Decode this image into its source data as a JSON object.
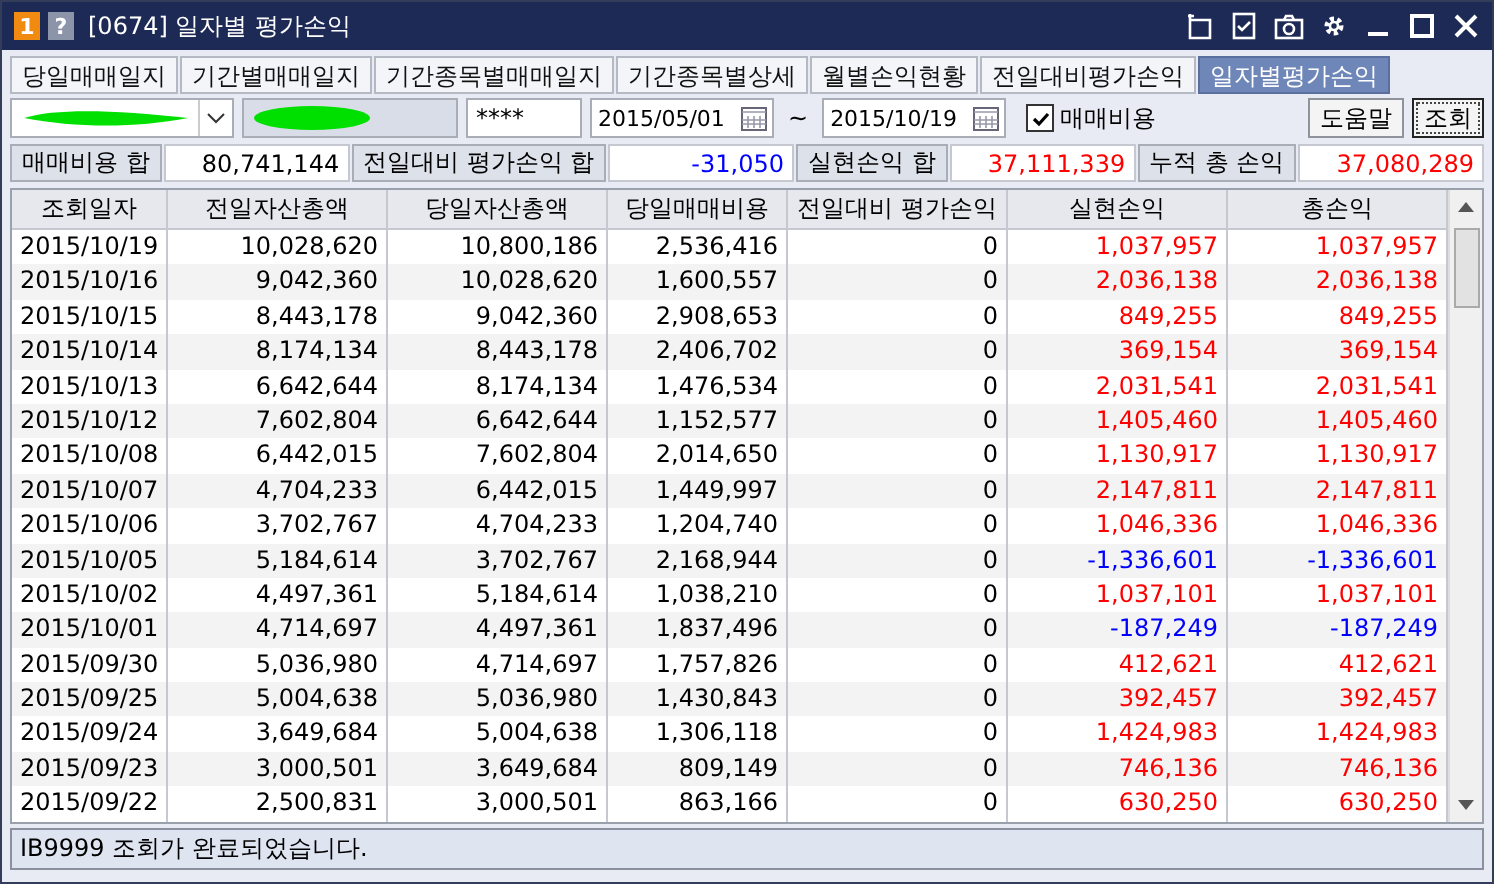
{
  "window": {
    "badge": "1",
    "help": "?",
    "title": "[0674] 일자별 평가손익"
  },
  "tabs": [
    {
      "label": "당일매매일지",
      "selected": false
    },
    {
      "label": "기간별매매일지",
      "selected": false
    },
    {
      "label": "기간종목별매매일지",
      "selected": false
    },
    {
      "label": "기간종목별상세",
      "selected": false
    },
    {
      "label": "월별손익현황",
      "selected": false
    },
    {
      "label": "전일대비평가손익",
      "selected": false
    },
    {
      "label": "일자별평가손익",
      "selected": true
    }
  ],
  "controls": {
    "password": "****",
    "start_date": "2015/05/01",
    "separator": "~",
    "end_date": "2015/10/19",
    "fee_checkbox": {
      "label": "매매비용",
      "checked": true
    },
    "buttons": [
      "도움말",
      "조회"
    ]
  },
  "summary": [
    {
      "label": "매매비용 합",
      "value": "80,741,144",
      "color": "#000000"
    },
    {
      "label": "전일대비 평가손익 합",
      "value": "-31,050",
      "color": "#0000ff"
    },
    {
      "label": "실현손익 합",
      "value": "37,111,339",
      "color": "#ff0000"
    },
    {
      "label": "누적 총 손익",
      "value": "37,080,289",
      "color": "#ff0000"
    }
  ],
  "table": {
    "columns": [
      "조회일자",
      "전일자산총액",
      "당일자산총액",
      "당일매매비용",
      "전일대비 평가손익",
      "실현손익",
      "총손익"
    ],
    "rows": [
      {
        "cells": [
          "2015/10/19",
          "10,028,620",
          "10,800,186",
          "2,536,416",
          "0",
          "1,037,957",
          "1,037,957"
        ],
        "color": "#ff0000"
      },
      {
        "cells": [
          "2015/10/16",
          "9,042,360",
          "10,028,620",
          "1,600,557",
          "0",
          "2,036,138",
          "2,036,138"
        ],
        "color": "#ff0000"
      },
      {
        "cells": [
          "2015/10/15",
          "8,443,178",
          "9,042,360",
          "2,908,653",
          "0",
          "849,255",
          "849,255"
        ],
        "color": "#ff0000"
      },
      {
        "cells": [
          "2015/10/14",
          "8,174,134",
          "8,443,178",
          "2,406,702",
          "0",
          "369,154",
          "369,154"
        ],
        "color": "#ff0000"
      },
      {
        "cells": [
          "2015/10/13",
          "6,642,644",
          "8,174,134",
          "1,476,534",
          "0",
          "2,031,541",
          "2,031,541"
        ],
        "color": "#ff0000"
      },
      {
        "cells": [
          "2015/10/12",
          "7,602,804",
          "6,642,644",
          "1,152,577",
          "0",
          "1,405,460",
          "1,405,460"
        ],
        "color": "#ff0000"
      },
      {
        "cells": [
          "2015/10/08",
          "6,442,015",
          "7,602,804",
          "2,014,650",
          "0",
          "1,130,917",
          "1,130,917"
        ],
        "color": "#ff0000"
      },
      {
        "cells": [
          "2015/10/07",
          "4,704,233",
          "6,442,015",
          "1,449,997",
          "0",
          "2,147,811",
          "2,147,811"
        ],
        "color": "#ff0000"
      },
      {
        "cells": [
          "2015/10/06",
          "3,702,767",
          "4,704,233",
          "1,204,740",
          "0",
          "1,046,336",
          "1,046,336"
        ],
        "color": "#ff0000"
      },
      {
        "cells": [
          "2015/10/05",
          "5,184,614",
          "3,702,767",
          "2,168,944",
          "0",
          "-1,336,601",
          "-1,336,601"
        ],
        "color": "#0000ff"
      },
      {
        "cells": [
          "2015/10/02",
          "4,497,361",
          "5,184,614",
          "1,038,210",
          "0",
          "1,037,101",
          "1,037,101"
        ],
        "color": "#ff0000"
      },
      {
        "cells": [
          "2015/10/01",
          "4,714,697",
          "4,497,361",
          "1,837,496",
          "0",
          "-187,249",
          "-187,249"
        ],
        "color": "#0000ff"
      },
      {
        "cells": [
          "2015/09/30",
          "5,036,980",
          "4,714,697",
          "1,757,826",
          "0",
          "412,621",
          "412,621"
        ],
        "color": "#ff0000"
      },
      {
        "cells": [
          "2015/09/25",
          "5,004,638",
          "5,036,980",
          "1,430,843",
          "0",
          "392,457",
          "392,457"
        ],
        "color": "#ff0000"
      },
      {
        "cells": [
          "2015/09/24",
          "3,649,684",
          "5,004,638",
          "1,306,118",
          "0",
          "1,424,983",
          "1,424,983"
        ],
        "color": "#ff0000"
      },
      {
        "cells": [
          "2015/09/23",
          "3,000,501",
          "3,649,684",
          "809,149",
          "0",
          "746,136",
          "746,136"
        ],
        "color": "#ff0000"
      },
      {
        "cells": [
          "2015/09/22",
          "2,500,831",
          "3,000,501",
          "863,166",
          "0",
          "630,250",
          "630,250"
        ],
        "color": "#ff0000"
      }
    ]
  },
  "status_bar": "IB9999  조회가 완료되었습니다."
}
